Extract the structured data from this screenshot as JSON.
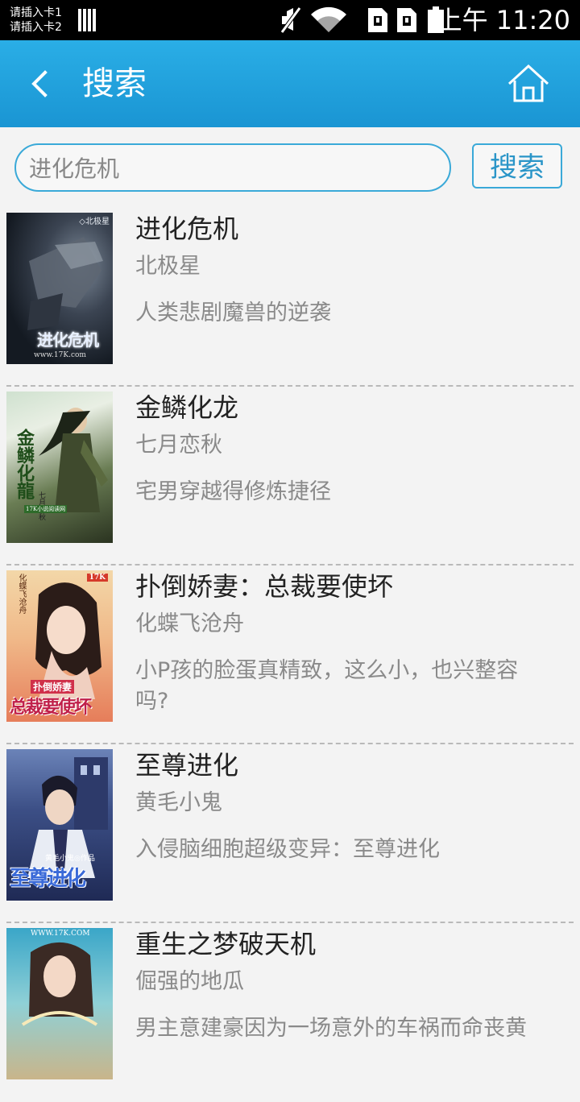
{
  "status_bar": {
    "sim1": "请插入卡1",
    "sim2": "请插入卡2",
    "time": "上午 11:20"
  },
  "header": {
    "title": "搜索",
    "back_icon": "chevron-left-icon",
    "home_icon": "home-icon"
  },
  "search": {
    "value": "进化危机",
    "button_label": "搜索"
  },
  "results": [
    {
      "title": "进化危机",
      "author": "北极星",
      "desc": "人类悲剧魔兽的逆袭"
    },
    {
      "title": "金鳞化龙",
      "author": "七月恋秋",
      "desc": "宅男穿越得修炼捷径"
    },
    {
      "title": "扑倒娇妻：总裁要使坏",
      "author": "化蝶飞沧舟",
      "desc": "小P孩的脸蛋真精致，这么小，也兴整容吗?"
    },
    {
      "title": "至尊进化",
      "author": "黄毛小鬼",
      "desc": "入侵脑细胞超级变异：至尊进化"
    },
    {
      "title": "重生之梦破天机",
      "author": "倔强的地瓜",
      "desc": "男主意建豪因为一场意外的车祸而命丧黄"
    }
  ],
  "covers": {
    "c1_top": "◇北极星",
    "c1_art": "进化危机",
    "c1_url": "www.17K.com",
    "c2_art": "金鳞化龍",
    "c2_author": "七月恋秋",
    "c2_tag": "17K小说阅读网",
    "c3_author": "化蝶飞沧舟",
    "c3_logo": "17K",
    "c3_art1": "扑倒娇妻",
    "c3_art2": "总裁要使坏",
    "c4_author": "黄毛小鬼◎作品",
    "c4_art": "至尊进化",
    "c5_url": "WWW.17K.COM"
  }
}
